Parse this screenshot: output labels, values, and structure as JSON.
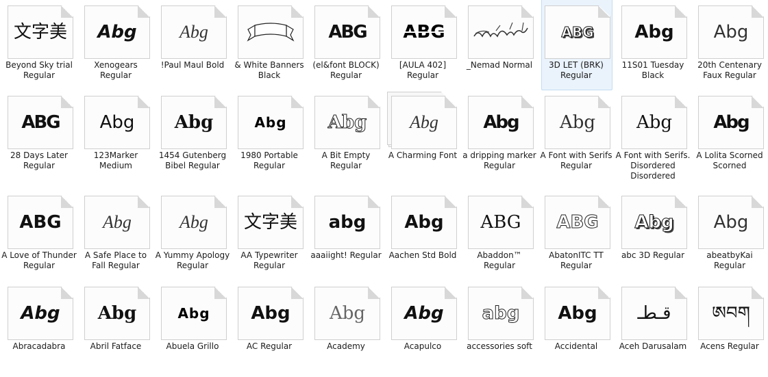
{
  "fonts": [
    {
      "name": "Beyond Sky trial Regular",
      "preview": "文字美",
      "style": "normal",
      "selected": false
    },
    {
      "name": "Xenogears Regular",
      "preview": "Abg",
      "style": "italic bold",
      "selected": false
    },
    {
      "name": "!Paul Maul Bold",
      "preview": "Abg",
      "style": "script",
      "selected": false
    },
    {
      "name": "& White Banners Black",
      "preview": "",
      "style": "banner",
      "selected": false
    },
    {
      "name": "(el&font BLOCK) Regular",
      "preview": "ABG",
      "style": "grunge",
      "selected": false
    },
    {
      "name": "[AULA 402] Regular",
      "preview": "ABG",
      "style": "stencil",
      "selected": false
    },
    {
      "name": "_Nemad Normal",
      "preview": "",
      "style": "arabic-calligraphy",
      "selected": false
    },
    {
      "name": "3D LET (BRK) Regular",
      "preview": "ABG",
      "style": "3d-cubes",
      "selected": true
    },
    {
      "name": "11S01 Tuesday Black",
      "preview": "Abg",
      "style": "bold",
      "selected": false
    },
    {
      "name": "20th Centenary Faux Regular",
      "preview": "Abg",
      "style": "light",
      "selected": false
    },
    {
      "name": "28 Days Later Regular",
      "preview": "ABG",
      "style": "grunge",
      "selected": false
    },
    {
      "name": "123Marker Medium",
      "preview": "Abg",
      "style": "normal",
      "selected": false
    },
    {
      "name": "1454 Gutenberg Bibel Regular",
      "preview": "Abg",
      "style": "blackletter",
      "selected": false
    },
    {
      "name": "1980 Portable Regular",
      "preview": "Abg",
      "style": "dotted",
      "selected": false
    },
    {
      "name": "A Bit Empty Regular",
      "preview": "Abg",
      "style": "outline-serif",
      "selected": false
    },
    {
      "name": "A Charming Font",
      "preview": "Abg",
      "style": "script-stack",
      "selected": false
    },
    {
      "name": "a dripping marker Regular",
      "preview": "Abg",
      "style": "grunge",
      "selected": false
    },
    {
      "name": "A Font with Serifs Regular",
      "preview": "Abg",
      "style": "thin-serif",
      "selected": false
    },
    {
      "name": "A Font with Serifs. Disordered Disordered",
      "preview": "Abg",
      "style": "disordered",
      "selected": false
    },
    {
      "name": "A Lolita Scorned Scorned",
      "preview": "Abg",
      "style": "grunge",
      "selected": false
    },
    {
      "name": "A Love of Thunder Regular",
      "preview": "ABG",
      "style": "bold",
      "selected": false
    },
    {
      "name": "A Safe Place to Fall Regular",
      "preview": "Abg",
      "style": "script",
      "selected": false
    },
    {
      "name": "A Yummy Apology Regular",
      "preview": "Abg",
      "style": "script",
      "selected": false
    },
    {
      "name": "AA Typewriter Regular",
      "preview": "文字美",
      "style": "normal",
      "selected": false
    },
    {
      "name": "aaaiight! Regular",
      "preview": "abg",
      "style": "bold-round",
      "selected": false
    },
    {
      "name": "Aachen Std Bold",
      "preview": "Abg",
      "style": "bold",
      "selected": false
    },
    {
      "name": "Abaddon™ Regular",
      "preview": "ABG",
      "style": "serif",
      "selected": false
    },
    {
      "name": "AbatonITC TT Regular",
      "preview": "ABG",
      "style": "outline",
      "selected": false
    },
    {
      "name": "abc 3D Regular",
      "preview": "Abg",
      "style": "3d",
      "selected": false
    },
    {
      "name": "abeatbyKai Regular",
      "preview": "Abg",
      "style": "light",
      "selected": false
    },
    {
      "name": "Abracadabra",
      "preview": "Abg",
      "style": "italic bold",
      "selected": false
    },
    {
      "name": "Abril Fatface",
      "preview": "Abg",
      "style": "serif bold",
      "selected": false
    },
    {
      "name": "Abuela Grillo",
      "preview": "Abg",
      "style": "dotted",
      "selected": false
    },
    {
      "name": "AC Regular",
      "preview": "Abg",
      "style": "bold",
      "selected": false
    },
    {
      "name": "Academy",
      "preview": "Abg",
      "style": "serif grey",
      "selected": false
    },
    {
      "name": "Acapulco",
      "preview": "Abg",
      "style": "italic bold",
      "selected": false
    },
    {
      "name": "accessories soft",
      "preview": "abg",
      "style": "outline",
      "selected": false
    },
    {
      "name": "Accidental",
      "preview": "Abg",
      "style": "bold",
      "selected": false
    },
    {
      "name": "Aceh Darusalam",
      "preview": "قـطـ",
      "style": "arabic",
      "selected": false
    },
    {
      "name": "Acens Regular",
      "preview": "ཨབག",
      "style": "tibetan",
      "selected": false
    }
  ]
}
